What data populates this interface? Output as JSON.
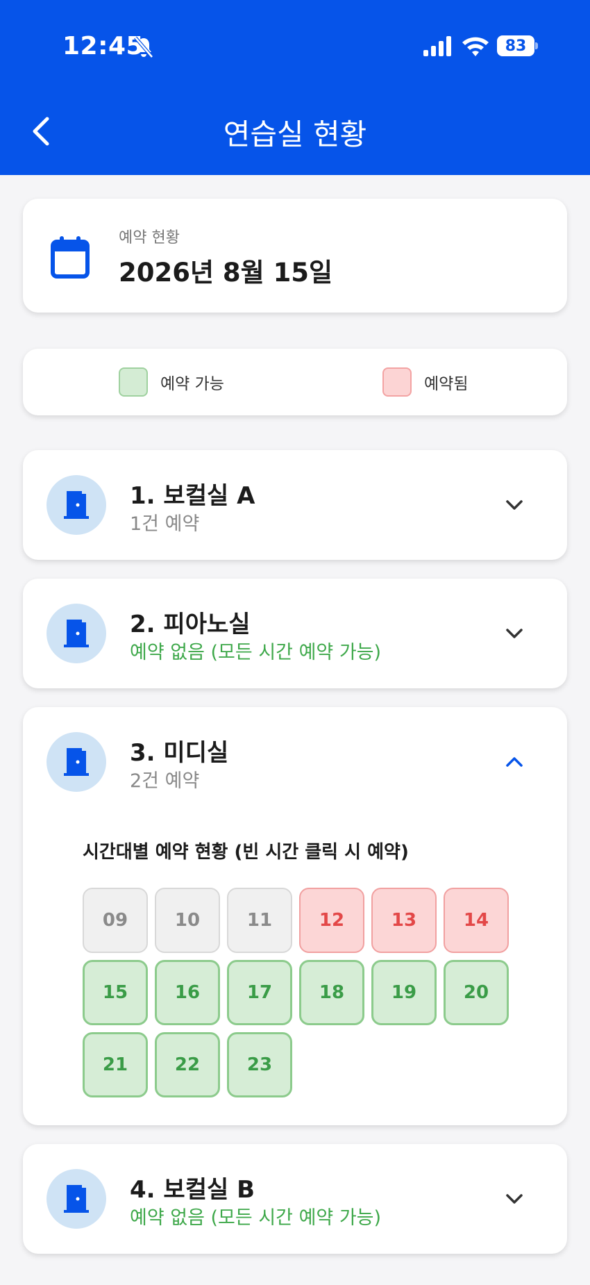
{
  "status_bar": {
    "time": "12:45",
    "battery": "83"
  },
  "header": {
    "title": "연습실 현황"
  },
  "date_card": {
    "label": "예약 현황",
    "date": "2026년 8월 15일"
  },
  "legend": {
    "available": "예약 가능",
    "booked": "예약됨"
  },
  "rooms": [
    {
      "title": "1. 보컬실 A",
      "subtitle": "1건 예약",
      "subtitle_color": "gray",
      "expanded": false
    },
    {
      "title": "2. 피아노실",
      "subtitle": "예약 없음 (모든 시간 예약 가능)",
      "subtitle_color": "green",
      "expanded": false
    },
    {
      "title": "3. 미디실",
      "subtitle": "2건 예약",
      "subtitle_color": "gray",
      "expanded": true,
      "slots_label": "시간대별 예약 현황 (빈 시간 클릭 시 예약)",
      "slots": [
        {
          "hour": "09",
          "state": "past"
        },
        {
          "hour": "10",
          "state": "past"
        },
        {
          "hour": "11",
          "state": "past"
        },
        {
          "hour": "12",
          "state": "booked"
        },
        {
          "hour": "13",
          "state": "booked"
        },
        {
          "hour": "14",
          "state": "booked"
        },
        {
          "hour": "15",
          "state": "available"
        },
        {
          "hour": "16",
          "state": "available"
        },
        {
          "hour": "17",
          "state": "available"
        },
        {
          "hour": "18",
          "state": "available"
        },
        {
          "hour": "19",
          "state": "available"
        },
        {
          "hour": "20",
          "state": "available"
        },
        {
          "hour": "21",
          "state": "available"
        },
        {
          "hour": "22",
          "state": "available"
        },
        {
          "hour": "23",
          "state": "available"
        }
      ]
    },
    {
      "title": "4. 보컬실 B",
      "subtitle": "예약 없음 (모든 시간 예약 가능)",
      "subtitle_color": "green",
      "expanded": false
    }
  ],
  "colors": {
    "primary": "#0654e9",
    "available_text": "#3a9c47",
    "booked_text": "#e34848",
    "past_text": "#8a8a8a"
  },
  "icons": {
    "back": "back-chevron-icon",
    "calendar": "calendar-icon",
    "room": "door-icon",
    "expand": "chevron-down-icon",
    "collapse": "chevron-up-icon"
  }
}
